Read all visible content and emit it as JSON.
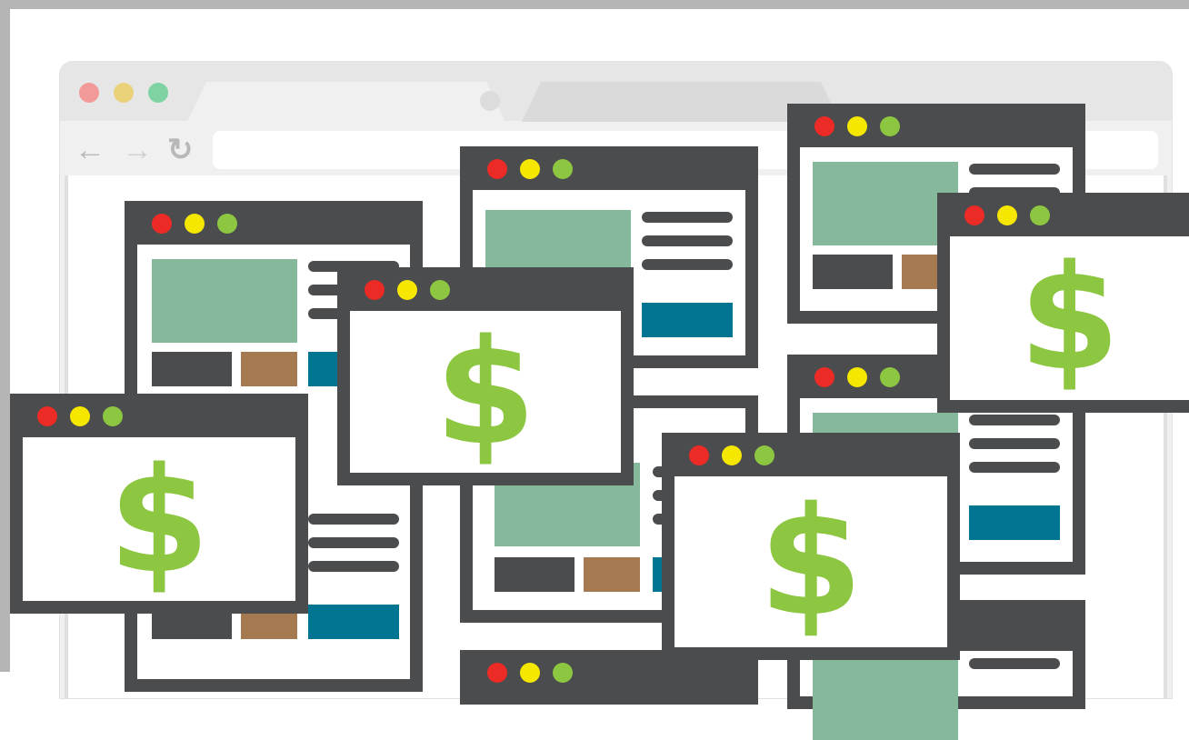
{
  "colors": {
    "window_frame": "#4b4c4e",
    "dot_red": "#ec2a26",
    "dot_yellow": "#f6e700",
    "dot_green": "#8dc641",
    "image_block": "#86b99c",
    "button_teal": "#007592",
    "block_brown": "#a57a50",
    "dollar_green": "#8dc641",
    "background_browser": "#f0f0f0"
  },
  "browser": {
    "back_icon": "←",
    "forward_icon": "→",
    "reload_icon": "↻"
  },
  "dollar_sign": "$"
}
